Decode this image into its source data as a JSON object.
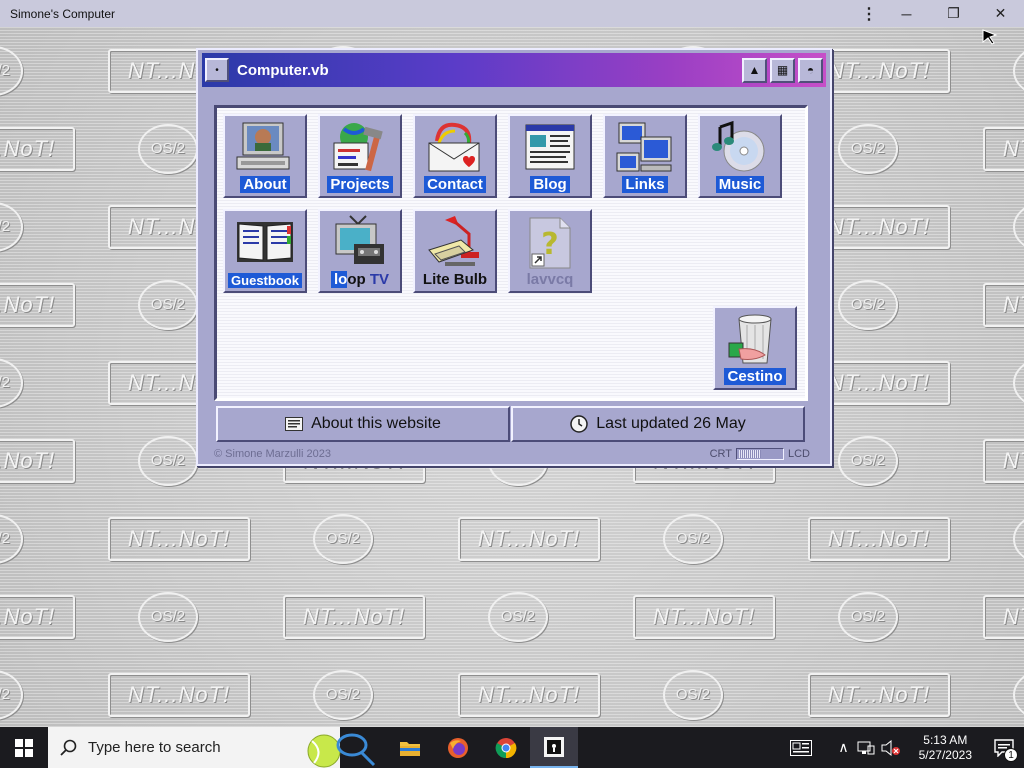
{
  "app": {
    "title": "Simone's Computer",
    "menu_icon": "kebab-menu-icon",
    "minimize": "─",
    "restore": "❐",
    "close": "✕"
  },
  "wallpaper": {
    "nt_text": "NT...NoT!",
    "os2_text": "OS/2"
  },
  "window": {
    "title": "Computer.vb",
    "title_gradient": [
      "#2b3aa8",
      "#c64fc8"
    ],
    "buttons": {
      "system": "•",
      "maximize": "▲",
      "grid": "▦",
      "shade": "◓"
    },
    "icons": [
      {
        "label": "About",
        "icon": "computer-user-icon",
        "style": "selected"
      },
      {
        "label": "Projects",
        "icon": "projects-globe-icon",
        "style": "selected"
      },
      {
        "label": "Contact",
        "icon": "mail-heart-icon",
        "style": "selected"
      },
      {
        "label": "Blog",
        "icon": "web-page-icon",
        "style": "selected"
      },
      {
        "label": "Links",
        "icon": "network-computers-icon",
        "style": "selected"
      },
      {
        "label": "Music",
        "icon": "music-cd-icon",
        "style": "selected"
      },
      {
        "label": "Guestbook",
        "icon": "open-book-icon",
        "style": "selected"
      },
      {
        "label_parts": [
          "lo",
          "op",
          " TV"
        ],
        "icon": "retro-tv-icon",
        "style": "mixed"
      },
      {
        "label": "Lite Bulb",
        "icon": "desk-lamp-icon",
        "style": "plain"
      },
      {
        "label": "lavvcq",
        "icon": "unknown-shortcut-icon",
        "style": "disabled"
      }
    ],
    "trash": {
      "label": "Cestino",
      "icon": "recycle-bin-icon"
    },
    "status": {
      "about_label": "About this website",
      "updated_label": "Last updated 26 May"
    },
    "footer": {
      "copyright": "© Simone Marzulli 2023",
      "crt": "CRT",
      "lcd": "LCD",
      "crt_level": 0.45
    }
  },
  "taskbar": {
    "search_placeholder": "Type here to search",
    "apps": [
      "file-explorer-icon",
      "firefox-icon",
      "chrome-icon",
      "active-app-icon"
    ],
    "time": "5:13 AM",
    "date": "5/27/2023",
    "notification_count": "1"
  },
  "colors": {
    "window_bg": "#a7a7ce",
    "selection": "#1e5ad6",
    "taskbar": "#1b1b1f"
  }
}
